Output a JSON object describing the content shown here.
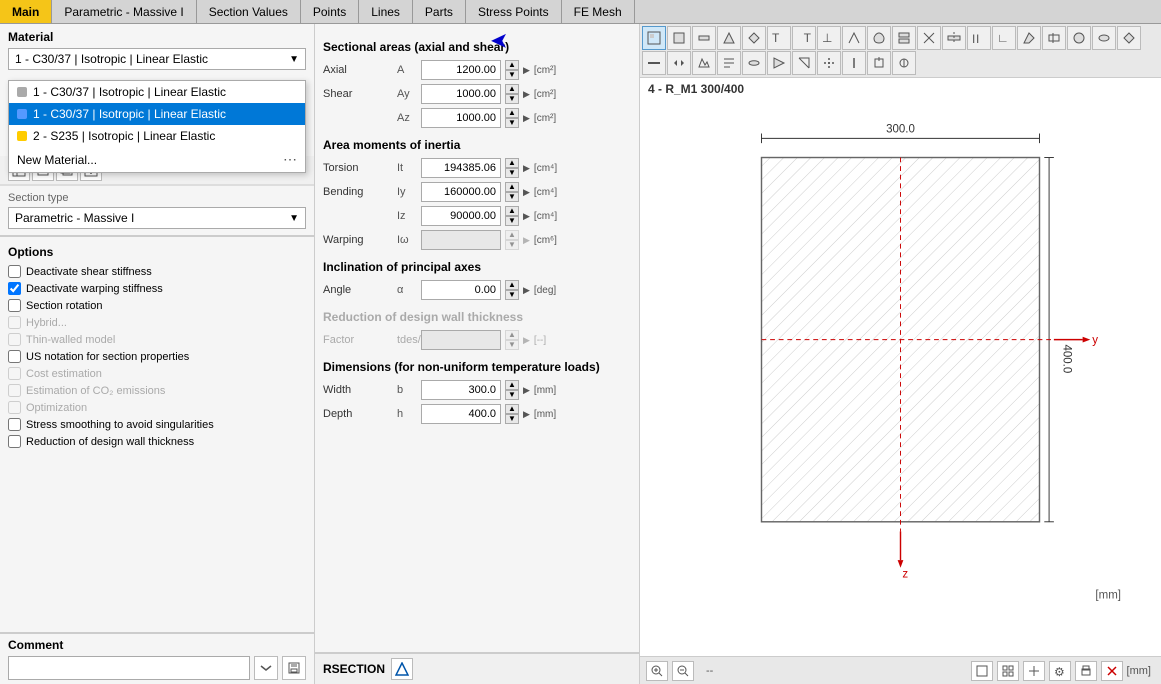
{
  "tabs": [
    {
      "label": "Main",
      "active": true
    },
    {
      "label": "Parametric - Massive I",
      "active": false
    },
    {
      "label": "Section Values",
      "active": false
    },
    {
      "label": "Points",
      "active": false
    },
    {
      "label": "Lines",
      "active": false
    },
    {
      "label": "Parts",
      "active": false
    },
    {
      "label": "Stress Points",
      "active": false
    },
    {
      "label": "FE Mesh",
      "active": false
    }
  ],
  "material": {
    "label": "Material",
    "selected": "1 - C30/37 | Isotropic | Linear Elastic",
    "dropdown_items": [
      {
        "text": "1 - C30/37 | Isotropic | Linear Elastic",
        "color": "#cccccc",
        "selected": false
      },
      {
        "text": "1 - C30/37 | Isotropic | Linear Elastic",
        "color": "#5599ff",
        "selected": true
      },
      {
        "text": "2 - S235 | Isotropic | Linear Elastic",
        "color": "#ffcc00",
        "selected": false
      },
      {
        "text": "New Material...",
        "color": null,
        "selected": false
      }
    ]
  },
  "section_type": {
    "label": "Section type",
    "value": "Parametric - Massive I"
  },
  "sectional_areas": {
    "title": "Sectional areas (axial and shear)",
    "rows": [
      {
        "label": "Axial",
        "symbol": "A",
        "value": "1200.00",
        "unit": "[cm²]"
      },
      {
        "label": "Shear",
        "symbol": "Ay",
        "value": "1000.00",
        "unit": "[cm²]"
      },
      {
        "label": "",
        "symbol": "Az",
        "value": "1000.00",
        "unit": "[cm²]"
      }
    ]
  },
  "area_moments": {
    "title": "Area moments of inertia",
    "rows": [
      {
        "label": "Torsion",
        "symbol": "It",
        "value": "194385.06",
        "unit": "[cm⁴]"
      },
      {
        "label": "Bending",
        "symbol": "Iy",
        "value": "160000.00",
        "unit": "[cm⁴]"
      },
      {
        "label": "",
        "symbol": "Iz",
        "value": "90000.00",
        "unit": "[cm⁴]"
      },
      {
        "label": "Warping",
        "symbol": "Iω",
        "value": "",
        "unit": "[cm⁶]",
        "disabled": true
      }
    ]
  },
  "inclination": {
    "title": "Inclination of principal axes",
    "rows": [
      {
        "label": "Angle",
        "symbol": "α",
        "value": "0.00",
        "unit": "[deg]"
      }
    ]
  },
  "reduction": {
    "title": "Reduction of design wall thickness",
    "rows": [
      {
        "label": "Factor",
        "symbol": "tdes/t",
        "value": "",
        "unit": "[--]",
        "disabled": true
      }
    ]
  },
  "dimensions": {
    "title": "Dimensions (for non-uniform temperature loads)",
    "rows": [
      {
        "label": "Width",
        "symbol": "b",
        "value": "300.0",
        "unit": "[mm]"
      },
      {
        "label": "Depth",
        "symbol": "h",
        "value": "400.0",
        "unit": "[mm]"
      }
    ]
  },
  "options": {
    "header": "Options",
    "items": [
      {
        "label": "Deactivate shear stiffness",
        "checked": false,
        "disabled": false
      },
      {
        "label": "Deactivate warping stiffness",
        "checked": true,
        "disabled": false
      },
      {
        "label": "Section rotation",
        "checked": false,
        "disabled": false
      },
      {
        "label": "Hybrid...",
        "checked": false,
        "disabled": true
      },
      {
        "label": "Thin-walled model",
        "checked": false,
        "disabled": true
      },
      {
        "label": "US notation for section properties",
        "checked": false,
        "disabled": false
      },
      {
        "label": "Cost estimation",
        "checked": false,
        "disabled": true
      },
      {
        "label": "Estimation of CO₂ emissions",
        "checked": false,
        "disabled": true
      },
      {
        "label": "Optimization",
        "checked": false,
        "disabled": true
      },
      {
        "label": "Stress smoothing to avoid singularities",
        "checked": false,
        "disabled": false
      },
      {
        "label": "Reduction of design wall thickness",
        "checked": false,
        "disabled": false
      }
    ]
  },
  "comment": {
    "label": "Comment"
  },
  "rsection": {
    "label": "RSECTION"
  },
  "drawing": {
    "section_name": "4 - R_M1 300/400",
    "dimension_top": "300.0",
    "dimension_right": "400.0",
    "unit": "[mm]",
    "status": "--"
  }
}
